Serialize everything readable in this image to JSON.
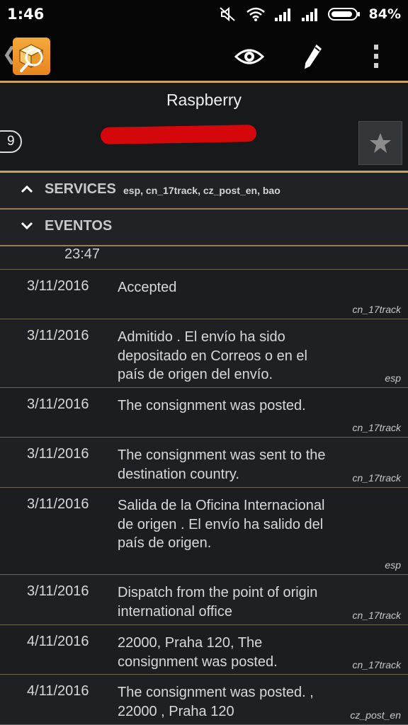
{
  "status_bar": {
    "time": "1:46",
    "battery_pct": "84%"
  },
  "app_bar": {
    "icons": [
      "back-chevron-icon",
      "app-package-icon",
      "eye-icon",
      "pencil-icon",
      "overflow-menu-icon"
    ]
  },
  "header": {
    "title": "Raspberry",
    "counter": "9",
    "favorite_icon": "star-icon"
  },
  "sections": {
    "services": {
      "label": "SERVICES",
      "list": "esp, cn_17track, cz_post_en, bao",
      "state": "expanded"
    },
    "eventos": {
      "label": "EVENTOS",
      "state": "expanded"
    }
  },
  "partial_event_time": "23:47",
  "events": [
    {
      "date": "3/11/2016",
      "desc": "Accepted",
      "service": "cn_17track"
    },
    {
      "date": "3/11/2016",
      "desc": "Admitido . El envío ha sido depositado en Correos o en el país de origen del envío.",
      "service": "esp"
    },
    {
      "date": "3/11/2016",
      "desc": "The consignment was posted.",
      "service": "cn_17track"
    },
    {
      "date": "3/11/2016",
      "desc": "The consignment was sent to the destination country.",
      "service": "cn_17track"
    },
    {
      "date": "3/11/2016",
      "desc": "Salida de la Oficina Internacional de origen . El envío ha salido del país de origen.",
      "service": "esp"
    },
    {
      "date": "3/11/2016",
      "desc": "Dispatch from the point of origin international office",
      "service": "cn_17track"
    },
    {
      "date": "4/11/2016",
      "desc": "22000, Praha 120, The consignment was posted.",
      "service": "cn_17track"
    },
    {
      "date": "4/11/2016",
      "desc": "The consignment was posted. , 22000 , Praha 120",
      "service": "cz_post_en"
    }
  ],
  "colors": {
    "accent_gold": "#c9a45c",
    "background": "#1e2023",
    "redaction": "#d4080b",
    "app_icon_orange": "#f5a93a"
  }
}
